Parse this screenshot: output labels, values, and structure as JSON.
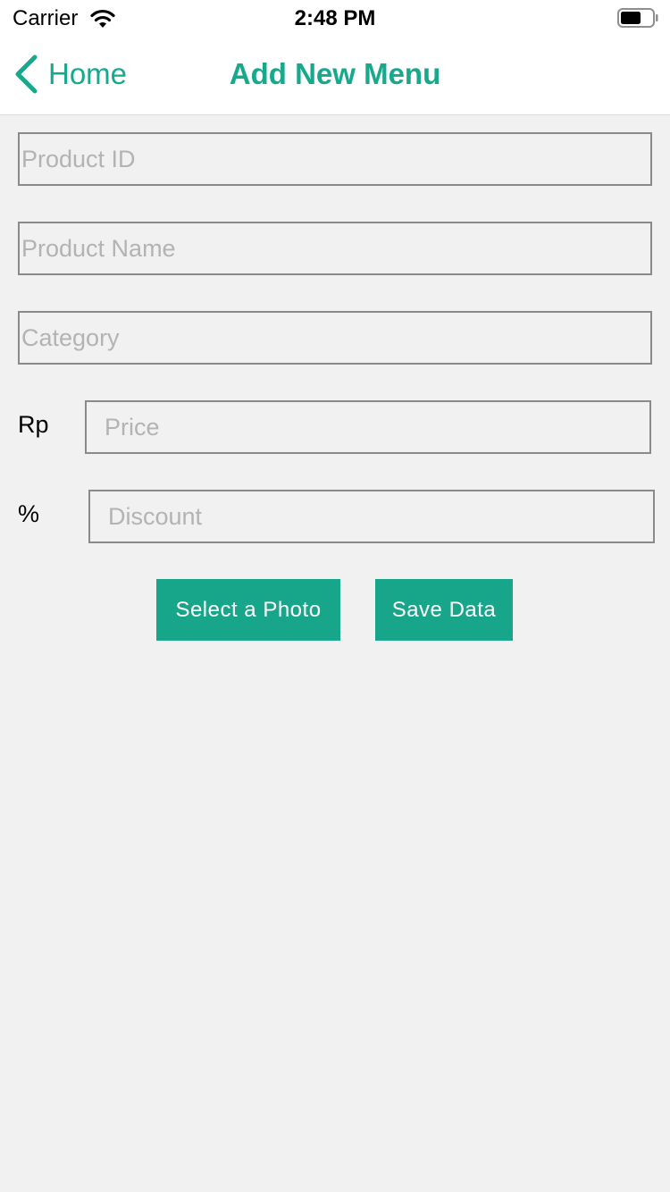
{
  "status_bar": {
    "carrier": "Carrier",
    "time": "2:48 PM",
    "wifi_icon": "wifi-icon",
    "battery_icon": "battery-icon"
  },
  "nav": {
    "back_label": "Home",
    "back_icon": "chevron-left-icon",
    "title": "Add New Menu"
  },
  "form": {
    "product_id": {
      "value": "",
      "placeholder": "Product ID"
    },
    "product_name": {
      "value": "",
      "placeholder": "Product Name"
    },
    "category": {
      "value": "",
      "placeholder": "Category"
    },
    "price": {
      "prefix": "Rp",
      "value": "",
      "placeholder": "Price"
    },
    "discount": {
      "prefix": "%",
      "value": "",
      "placeholder": "Discount"
    }
  },
  "actions": {
    "select_photo_label": "Select a Photo",
    "save_label": "Save Data"
  },
  "colors": {
    "accent": "#17a98c",
    "button": "#17a68a",
    "background": "#f1f1f1"
  }
}
